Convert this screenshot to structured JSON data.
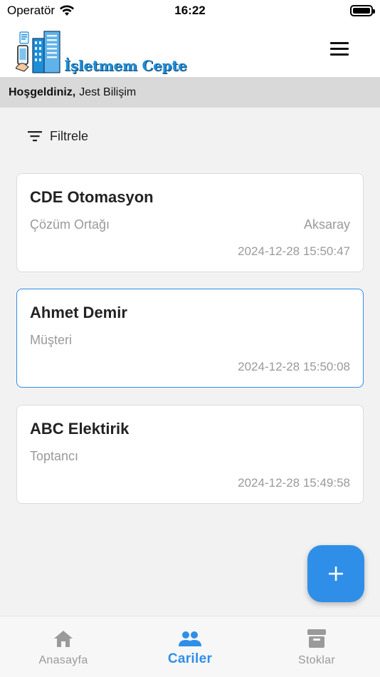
{
  "status_bar": {
    "carrier": "Operatör",
    "time": "16:22",
    "battery_level": 1.0
  },
  "header": {
    "logo_text": "İşletmem Cepte",
    "menu_icon": "hamburger-menu-icon"
  },
  "welcome": {
    "greeting": "Hoşgeldiniz,",
    "company": "Jest Bilişim"
  },
  "filter": {
    "label": "Filtrele",
    "icon": "filter-icon"
  },
  "cards": [
    {
      "name": "CDE Otomasyon",
      "type": "Çözüm Ortağı",
      "city": "Aksaray",
      "date": "2024-12-28 15:50:47",
      "selected": false
    },
    {
      "name": "Ahmet Demir",
      "type": "Müşteri",
      "city": "",
      "date": "2024-12-28 15:50:08",
      "selected": true
    },
    {
      "name": "ABC Elektirik",
      "type": "Toptancı",
      "city": "",
      "date": "2024-12-28 15:49:58",
      "selected": false
    }
  ],
  "fab": {
    "icon": "plus-icon"
  },
  "bottom_nav": {
    "items": [
      {
        "label": "Anasayfa",
        "icon": "home-icon",
        "active": false
      },
      {
        "label": "Cariler",
        "icon": "people-icon",
        "active": true
      },
      {
        "label": "Stoklar",
        "icon": "archive-icon",
        "active": false
      }
    ]
  },
  "colors": {
    "accent": "#2f8fe8",
    "muted_text": "#9a9a9a",
    "welcome_bg": "#d9d9d9",
    "page_bg": "#f2f2f2"
  }
}
